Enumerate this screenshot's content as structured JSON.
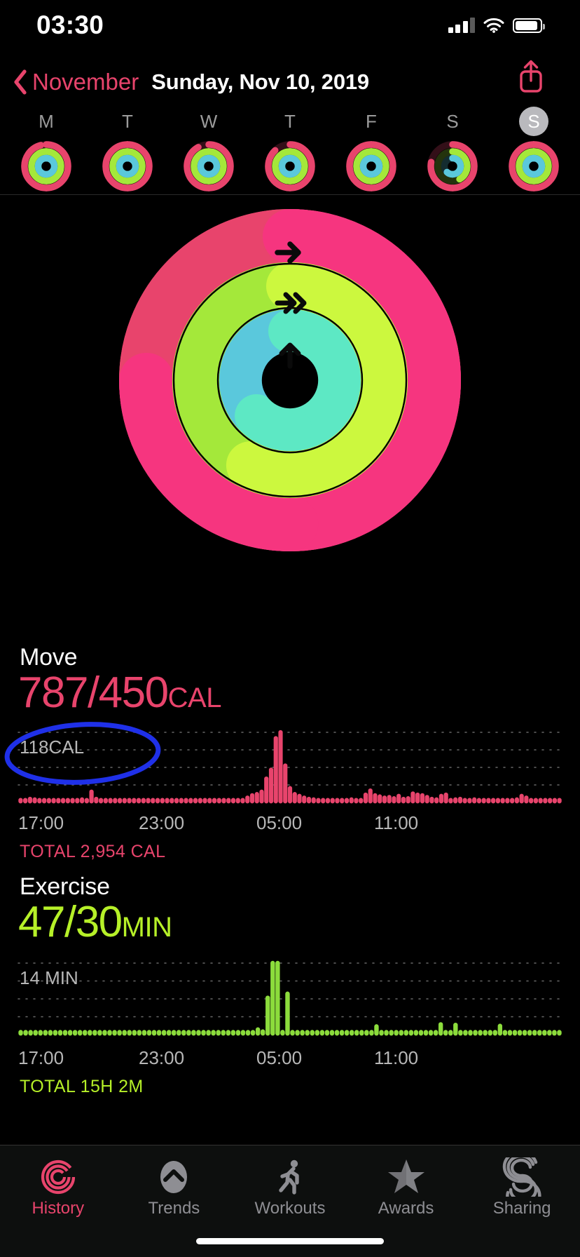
{
  "status_bar": {
    "time": "03:30",
    "signal_icon": "cellular-signal-icon",
    "signal_bars_filled": 3,
    "signal_bars_total": 4,
    "wifi_icon": "wifi-icon",
    "battery_icon": "battery-icon",
    "battery_level_pct": 88
  },
  "nav": {
    "back_icon": "chevron-left-icon",
    "back_label": "November",
    "title": "Sunday, Nov 10, 2019",
    "share_icon": "share-icon"
  },
  "week_strip": {
    "days": [
      {
        "letter": "M",
        "selected": false,
        "move_pct": 96,
        "exercise_pct": 100,
        "stand_pct": 100
      },
      {
        "letter": "T",
        "selected": false,
        "move_pct": 100,
        "exercise_pct": 100,
        "stand_pct": 100
      },
      {
        "letter": "W",
        "selected": false,
        "move_pct": 92,
        "exercise_pct": 100,
        "stand_pct": 100
      },
      {
        "letter": "T",
        "selected": false,
        "move_pct": 88,
        "exercise_pct": 100,
        "stand_pct": 100
      },
      {
        "letter": "F",
        "selected": false,
        "move_pct": 100,
        "exercise_pct": 100,
        "stand_pct": 100
      },
      {
        "letter": "S",
        "selected": false,
        "move_pct": 78,
        "exercise_pct": 42,
        "stand_pct": 62
      },
      {
        "letter": "S",
        "selected": true,
        "move_pct": 100,
        "exercise_pct": 100,
        "stand_pct": 100
      }
    ]
  },
  "rings": {
    "move": {
      "icon": "arrow-right-icon",
      "pct": 175,
      "color": "#e8446c",
      "cap_color": "#f6357f"
    },
    "exercise": {
      "icon": "double-chevron-right-icon",
      "pct": 157,
      "color": "#a4e83a",
      "cap_color": "#ccf83e"
    },
    "stand": {
      "icon": "arrow-up-icon",
      "pct": 162,
      "color": "#5ac8dc",
      "cap_color": "#5de8c4"
    }
  },
  "move": {
    "label": "Move",
    "value": "787/450",
    "unit": "CAL",
    "color": "#e8446c",
    "grid_label": "118CAL",
    "total": "TOTAL 2,954 CAL",
    "axis_ticks": [
      "17:00",
      "23:00",
      "05:00",
      "11:00"
    ],
    "annotation": {
      "shape": "ellipse",
      "color": "#1f30e8",
      "target": "TOTAL 2,954 CAL"
    }
  },
  "exercise": {
    "label": "Exercise",
    "value": "47/30",
    "unit": "MIN",
    "color": "#b6f028",
    "grid_label": "14 MIN",
    "total": "TOTAL 15H 2M",
    "axis_ticks": [
      "17:00",
      "23:00",
      "05:00",
      "11:00"
    ]
  },
  "chart_data": [
    {
      "type": "bar",
      "name": "move-chart",
      "title": "Move",
      "xlabel": "",
      "ylabel": "CAL",
      "ylim": [
        0,
        118
      ],
      "grid": true,
      "gridlines": [
        118,
        88.5,
        59,
        29.5
      ],
      "xtick_labels": [
        "17:00",
        "23:00",
        "05:00",
        "11:00"
      ],
      "xtick_positions": [
        0,
        24,
        48,
        72
      ],
      "color": "#e8446c",
      "values": [
        3,
        4,
        6,
        5,
        4,
        3,
        4,
        3,
        3,
        3,
        4,
        3,
        3,
        5,
        4,
        18,
        6,
        4,
        3,
        3,
        3,
        3,
        4,
        3,
        3,
        3,
        3,
        4,
        3,
        3,
        3,
        3,
        3,
        3,
        4,
        3,
        3,
        3,
        3,
        3,
        3,
        3,
        3,
        3,
        4,
        3,
        3,
        4,
        8,
        12,
        14,
        18,
        40,
        55,
        108,
        118,
        62,
        24,
        14,
        11,
        8,
        6,
        5,
        4,
        4,
        3,
        3,
        3,
        3,
        4,
        5,
        3,
        4,
        13,
        20,
        12,
        10,
        8,
        9,
        7,
        11,
        6,
        7,
        15,
        13,
        12,
        9,
        6,
        5,
        11,
        13,
        4,
        5,
        6,
        4,
        3,
        5,
        4,
        3,
        4,
        3,
        3,
        4,
        3,
        3,
        5,
        11,
        8,
        4,
        3,
        3,
        3,
        3,
        3,
        3
      ]
    },
    {
      "type": "bar",
      "name": "exercise-chart",
      "title": "Exercise",
      "xlabel": "",
      "ylabel": "MIN",
      "ylim": [
        0,
        14
      ],
      "grid": true,
      "gridlines": [
        14,
        10.5,
        7,
        3.5
      ],
      "xtick_labels": [
        "17:00",
        "23:00",
        "05:00",
        "11:00"
      ],
      "xtick_positions": [
        0,
        24,
        48,
        72
      ],
      "color": "#8cdc3c",
      "values": [
        0.4,
        0.4,
        0.4,
        0.4,
        0.4,
        0.4,
        0.4,
        0.4,
        0.4,
        0.4,
        0.4,
        0.4,
        0.4,
        0.4,
        0.4,
        0.4,
        0.4,
        0.4,
        0.4,
        0.4,
        0.4,
        0.4,
        0.4,
        0.4,
        0.4,
        0.4,
        0.4,
        0.4,
        0.4,
        0.4,
        0.4,
        0.4,
        0.4,
        0.4,
        0.4,
        0.4,
        0.4,
        0.4,
        0.4,
        0.4,
        0.4,
        0.4,
        0.4,
        0.4,
        0.4,
        0.4,
        0.4,
        0.4,
        1.0,
        0.6,
        7.2,
        14,
        14,
        0.5,
        8.0,
        0.4,
        0.4,
        0.4,
        0.4,
        0.4,
        0.4,
        0.4,
        0.4,
        0.4,
        0.4,
        0.4,
        0.4,
        0.4,
        0.4,
        0.4,
        0.4,
        0.4,
        1.6,
        0.4,
        0.4,
        0.4,
        0.4,
        0.4,
        0.4,
        0.4,
        0.4,
        0.4,
        0.4,
        0.4,
        0.4,
        2.0,
        0.4,
        0.4,
        1.9,
        0.4,
        0.4,
        0.4,
        0.4,
        0.4,
        0.4,
        0.4,
        0.4,
        1.7,
        0.4,
        0.4,
        0.4,
        0.4,
        0.4,
        0.4,
        0.4,
        0.4,
        0.4,
        0.4,
        0.4,
        0.4
      ]
    }
  ],
  "tab_bar": {
    "tabs": [
      {
        "label": "History",
        "icon": "activity-rings-icon",
        "active": true
      },
      {
        "label": "Trends",
        "icon": "chevron-up-circle-icon",
        "active": false
      },
      {
        "label": "Workouts",
        "icon": "running-person-icon",
        "active": false
      },
      {
        "label": "Awards",
        "icon": "star-icon",
        "active": false
      },
      {
        "label": "Sharing",
        "icon": "sharing-spiral-icon",
        "active": false
      }
    ],
    "home_indicator": "home-indicator"
  }
}
